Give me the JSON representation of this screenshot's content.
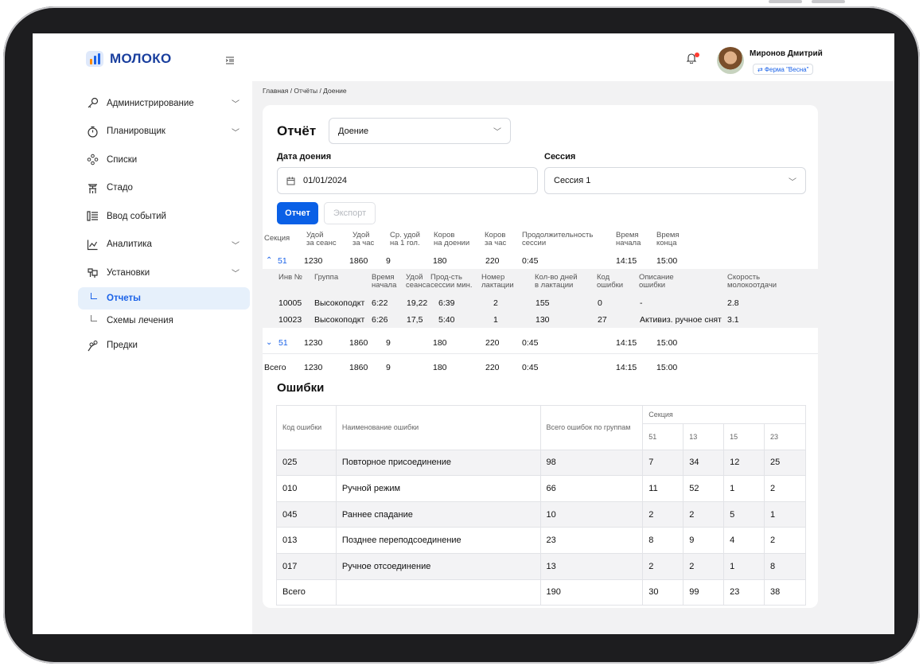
{
  "app": {
    "logo_text": "МОЛОКО"
  },
  "sidebar": {
    "items": [
      {
        "label": "Администрирование",
        "icon": "key-icon",
        "chevron": true
      },
      {
        "label": "Планировщик",
        "icon": "timer-icon",
        "chevron": true
      },
      {
        "label": "Списки",
        "icon": "nodes-icon",
        "chevron": false
      },
      {
        "label": "Стадо",
        "icon": "cow-icon",
        "chevron": false
      },
      {
        "label": "Ввод событий",
        "icon": "events-icon",
        "chevron": false
      },
      {
        "label": "Аналитика",
        "icon": "chart-icon",
        "chevron": true
      },
      {
        "label": "Установки",
        "icon": "settings-icon",
        "chevron": true
      }
    ],
    "subitems": [
      {
        "label": "Отчеты",
        "active": true
      },
      {
        "label": "Схемы лечения",
        "active": false
      }
    ],
    "extra": {
      "label": "Предки",
      "icon": "family-icon"
    }
  },
  "header": {
    "user_name": "Миронов Дмитрий",
    "farm": "⇄ Ферма \"Весна\""
  },
  "breadcrumb": "Главная / Отчёты / Доение",
  "report": {
    "title": "Отчёт",
    "type_value": "Доение",
    "date_label": "Дата доения",
    "date_value": "01/01/2024",
    "session_label": "Сессия",
    "session_value": "Сессия 1",
    "report_button": "Отчет",
    "export_button": "Экспорт"
  },
  "summary": {
    "headers": [
      "Секция",
      "Удой\nза сеанс",
      "Удой\nза час",
      "Ср. удой\nна 1 гол.",
      "Коров\nна доении",
      "Коров\nза час",
      "Продолжительность\nсессии",
      "Время\nначала",
      "Время\nконца"
    ],
    "rows": [
      {
        "toggle": "⌃",
        "section": "51",
        "milk_session": "1230",
        "milk_hour": "1860",
        "avg": "9",
        "cows": "180",
        "cows_hour": "220",
        "duration": "0:45",
        "start": "14:15",
        "end": "15:00"
      },
      {
        "toggle": "⌄",
        "section": "51",
        "milk_session": "1230",
        "milk_hour": "1860",
        "avg": "9",
        "cows": "180",
        "cows_hour": "220",
        "duration": "0:45",
        "start": "14:15",
        "end": "15:00"
      }
    ],
    "total": {
      "section": "Всего",
      "milk_session": "1230",
      "milk_hour": "1860",
      "avg": "9",
      "cows": "180",
      "cows_hour": "220",
      "duration": "0:45",
      "start": "14:15",
      "end": "15:00"
    }
  },
  "detail": {
    "headers": [
      "Инв №",
      "Группа",
      "Время\nначала",
      "Удой\nсеанса",
      "Прод-сть\nсессии мин.",
      "Номер\nлактации",
      "Кол-во дней\nв лактации",
      "Код\nошибки",
      "Описание\nошибки",
      "Скорость\nмолокоотдачи"
    ],
    "rows": [
      [
        "10005",
        "Высокоподкт",
        "6:22",
        "19,22",
        "6:39",
        "2",
        "155",
        "0",
        "-",
        "2.8"
      ],
      [
        "10023",
        "Высокоподкт",
        "6:26",
        "17,5",
        "5:40",
        "1",
        "130",
        "27",
        "Активиз. ручное снят",
        "3.1"
      ]
    ]
  },
  "errors": {
    "title": "Ошибки",
    "headers": {
      "code": "Код ошибки",
      "name": "Наименование ошибки",
      "total": "Всего ошибок по группам",
      "section": "Секция",
      "sections": [
        "51",
        "13",
        "15",
        "23"
      ]
    },
    "rows": [
      [
        "025",
        "Повторное присоединение",
        "98",
        "7",
        "34",
        "12",
        "25"
      ],
      [
        "010",
        "Ручной режим",
        "66",
        "11",
        "52",
        "1",
        "2"
      ],
      [
        "045",
        "Раннее спадание",
        "10",
        "2",
        "2",
        "5",
        "1"
      ],
      [
        "013",
        "Позднее переподсоединение",
        "23",
        "8",
        "9",
        "4",
        "2"
      ],
      [
        "017",
        "Ручное отсоединение",
        "13",
        "2",
        "2",
        "1",
        "8"
      ],
      [
        "Всего",
        "",
        "190",
        "30",
        "99",
        "23",
        "38"
      ]
    ]
  }
}
